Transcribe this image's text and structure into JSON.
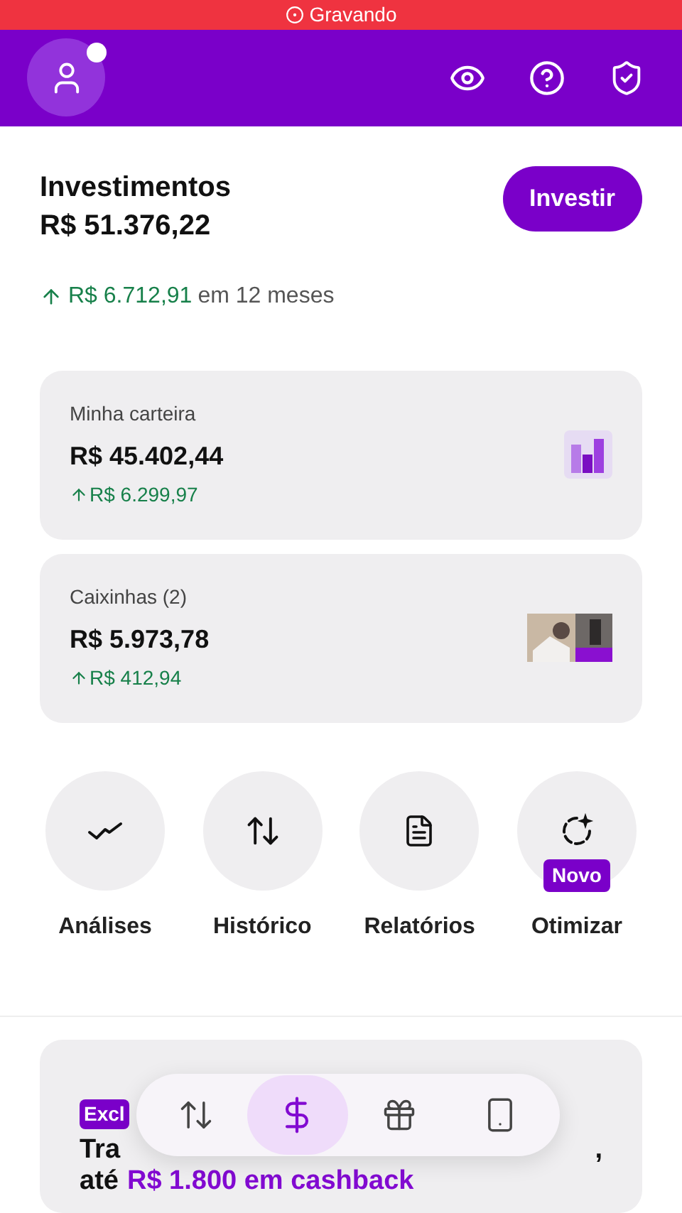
{
  "recording_bar": {
    "label": "Gravando"
  },
  "header": {
    "notification_dot": true
  },
  "summary": {
    "title": "Investimentos",
    "total": "R$ 51.376,22",
    "action": "Investir",
    "growth": "R$ 6.712,91",
    "growth_period": "em 12 meses"
  },
  "cards": [
    {
      "kind": "wallet",
      "title": "Minha carteira",
      "amount": "R$ 45.402,44",
      "gain": "R$ 6.299,97"
    },
    {
      "kind": "boxes",
      "title": "Caixinhas (2)",
      "amount": "R$ 5.973,78",
      "gain": "R$ 412,94"
    }
  ],
  "shortcuts": [
    {
      "kind": "analyses",
      "label": "Análises"
    },
    {
      "kind": "history",
      "label": "Histórico"
    },
    {
      "kind": "reports",
      "label": "Relatórios"
    },
    {
      "kind": "optimize",
      "label": "Otimizar",
      "badge": "Novo"
    }
  ],
  "promo": {
    "badge": "Excl",
    "line1": "Tra",
    "line1_end": ",",
    "line2_prefix": "até",
    "line2_highlight": "R$ 1.800 em cashback"
  },
  "bottom_nav": [
    {
      "kind": "transfers",
      "selected": false
    },
    {
      "kind": "money",
      "selected": true
    },
    {
      "kind": "gifts",
      "selected": false
    },
    {
      "kind": "phone",
      "selected": false
    }
  ]
}
